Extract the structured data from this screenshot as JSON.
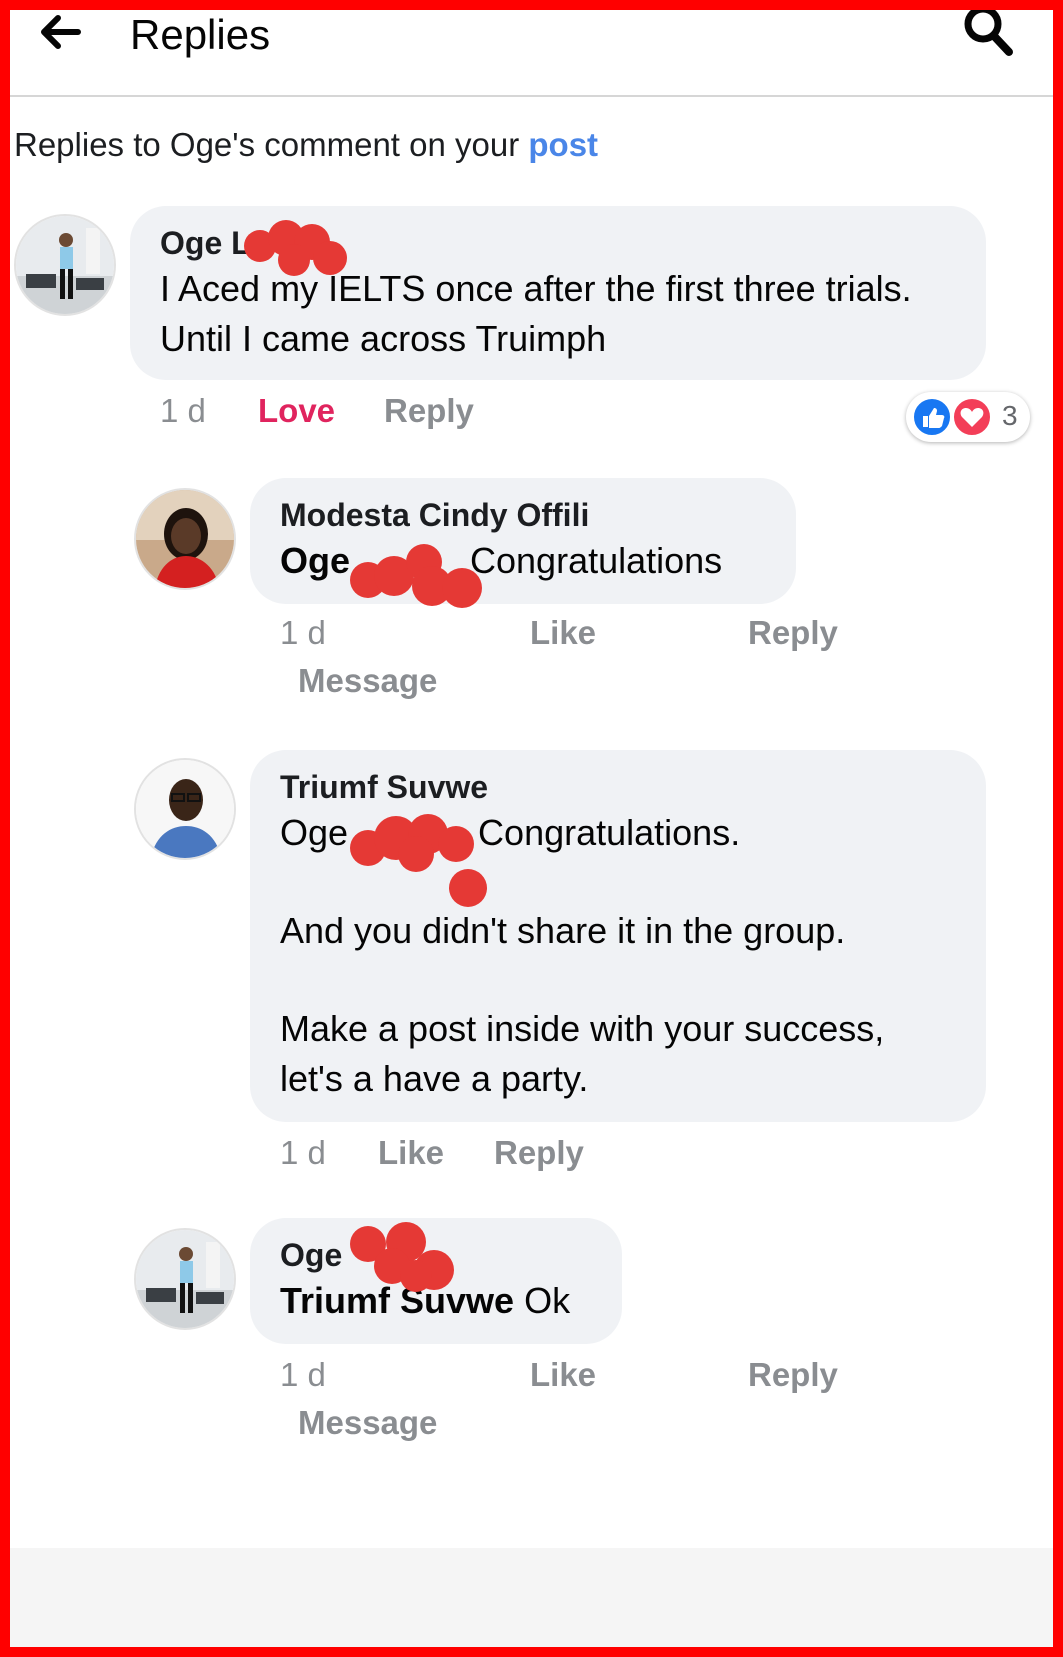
{
  "header": {
    "title": "Replies"
  },
  "subheader": {
    "prefix": "Replies to Oge's comment on your ",
    "link": "post"
  },
  "comments": [
    {
      "name": "Oge L",
      "text": "I Aced my IELTS once after the first three trials. Until I came across Truimph",
      "time": "1 d",
      "reaction_label": "Love",
      "reply_label": "Reply",
      "reaction_count": "3",
      "reaction_icons": [
        "like-icon",
        "love-icon"
      ],
      "reaction_color": "#e0245e"
    },
    {
      "name": "Modesta Cindy Offili",
      "mention": "Oge",
      "text": "Congratulations",
      "time": "1 d",
      "like_label": "Like",
      "reply_label": "Reply",
      "message_label": "Message"
    },
    {
      "name": "Triumf Suvwe",
      "mention": "Oge",
      "line1": "Congratulations.",
      "line2": "And you didn't share it in the group.",
      "line3": "Make a post inside with your success,",
      "line4": "let's a have a party.",
      "time": "1 d",
      "like_label": "Like",
      "reply_label": "Reply"
    },
    {
      "name": "Oge",
      "mention": "Triumf Suvwe",
      "text": "Ok",
      "time": "1 d",
      "like_label": "Like",
      "reply_label": "Reply",
      "message_label": "Message"
    }
  ],
  "colors": {
    "frame": "#ff0000",
    "link": "#4a86e8",
    "bubble": "#f0f2f5",
    "action_gray": "#8a8d91",
    "redaction": "#e53935"
  }
}
